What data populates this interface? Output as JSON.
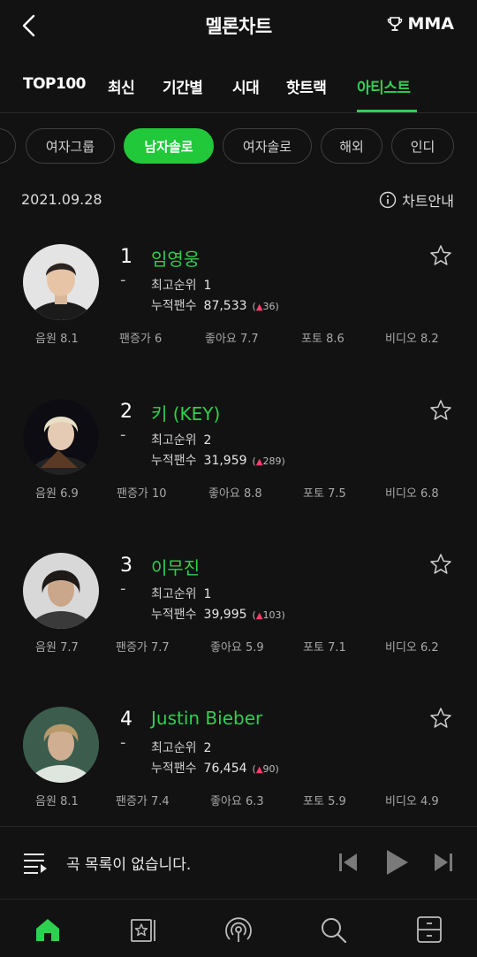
{
  "header": {
    "title": "멜론차트",
    "mma_label": "MMA",
    "back_icon": "chevron-left-icon",
    "trophy_icon": "trophy-icon"
  },
  "tabs": [
    {
      "label": "TOP100",
      "active": false
    },
    {
      "label": "최신",
      "active": false
    },
    {
      "label": "기간별",
      "active": false
    },
    {
      "label": "시대",
      "active": false
    },
    {
      "label": "핫트랙",
      "active": false
    },
    {
      "label": "아티스트",
      "active": true
    }
  ],
  "filters": [
    {
      "label": "여자그룹",
      "active": false
    },
    {
      "label": "남자솔로",
      "active": true
    },
    {
      "label": "여자솔로",
      "active": false
    },
    {
      "label": "해외",
      "active": false
    },
    {
      "label": "인디",
      "active": false
    }
  ],
  "chart_info": {
    "date": "2021.09.28",
    "guide_label": "차트안내"
  },
  "labels": {
    "best_rank": "최고순위",
    "fans": "누적팬수"
  },
  "artists": [
    {
      "rank": "1",
      "change": "-",
      "name": "임영웅",
      "best_rank": "1",
      "fans": "87,533",
      "fans_delta": "36",
      "scores": [
        {
          "label": "음원",
          "value": "8.1"
        },
        {
          "label": "팬증가",
          "value": "6"
        },
        {
          "label": "좋아요",
          "value": "7.7"
        },
        {
          "label": "포토",
          "value": "8.6"
        },
        {
          "label": "비디오",
          "value": "8.2"
        }
      ]
    },
    {
      "rank": "2",
      "change": "-",
      "name": "키 (KEY)",
      "best_rank": "2",
      "fans": "31,959",
      "fans_delta": "289",
      "scores": [
        {
          "label": "음원",
          "value": "6.9"
        },
        {
          "label": "팬증가",
          "value": "10"
        },
        {
          "label": "좋아요",
          "value": "8.8"
        },
        {
          "label": "포토",
          "value": "7.5"
        },
        {
          "label": "비디오",
          "value": "6.8"
        }
      ]
    },
    {
      "rank": "3",
      "change": "-",
      "name": "이무진",
      "best_rank": "1",
      "fans": "39,995",
      "fans_delta": "103",
      "scores": [
        {
          "label": "음원",
          "value": "7.7"
        },
        {
          "label": "팬증가",
          "value": "7.7"
        },
        {
          "label": "좋아요",
          "value": "5.9"
        },
        {
          "label": "포토",
          "value": "7.1"
        },
        {
          "label": "비디오",
          "value": "6.2"
        }
      ]
    },
    {
      "rank": "4",
      "change": "-",
      "name": "Justin Bieber",
      "best_rank": "2",
      "fans": "76,454",
      "fans_delta": "90",
      "scores": [
        {
          "label": "음원",
          "value": "8.1"
        },
        {
          "label": "팬증가",
          "value": "7.4"
        },
        {
          "label": "좋아요",
          "value": "6.3"
        },
        {
          "label": "포토",
          "value": "5.9"
        },
        {
          "label": "비디오",
          "value": "4.9"
        }
      ]
    }
  ],
  "player": {
    "empty_text": "곡 목록이 없습니다.",
    "icons": [
      "playlist-icon",
      "previous-icon",
      "play-icon",
      "next-icon"
    ]
  },
  "bottom_nav": [
    {
      "icon": "home-icon",
      "active": true
    },
    {
      "icon": "my-music-icon",
      "active": false
    },
    {
      "icon": "podcast-icon",
      "active": false
    },
    {
      "icon": "search-icon",
      "active": false
    },
    {
      "icon": "menu-drawer-icon",
      "active": false
    }
  ],
  "colors": {
    "background": "#121212",
    "accent": "#2fd04f",
    "pill_active": "#20c83a",
    "up_arrow": "#ff3e6c"
  }
}
